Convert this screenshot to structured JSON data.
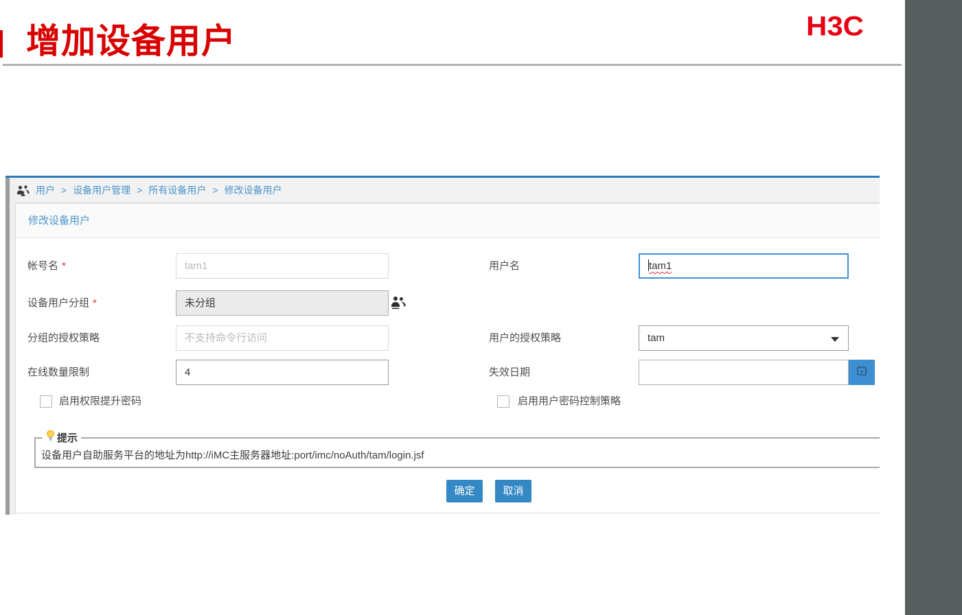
{
  "slide": {
    "title": "增加设备用户",
    "logo_text": "H3C"
  },
  "breadcrumb": {
    "separator": ">",
    "items": [
      "用户",
      "设备用户管理",
      "所有设备用户",
      "修改设备用户"
    ]
  },
  "panel": {
    "title": "修改设备用户"
  },
  "form": {
    "required_mark": "*",
    "account": {
      "label": "帐号名",
      "value": "tam1",
      "required": true,
      "state": "readonly"
    },
    "username": {
      "label": "用户名",
      "value": "tam1",
      "required": false,
      "state": "focused"
    },
    "group": {
      "label": "设备用户分组",
      "value": "未分组",
      "required": true,
      "state": "locked"
    },
    "group_policy": {
      "label": "分组的授权策略",
      "placeholder": "不支持命令行访问",
      "state": "readonly"
    },
    "user_policy": {
      "label": "用户的授权策略",
      "value": "tam",
      "control": "dropdown"
    },
    "online_limit": {
      "label": "在线数量限制",
      "value": "4"
    },
    "expire_date": {
      "label": "失效日期",
      "value": ""
    },
    "enable_priv_password": {
      "label": "启用权限提升密码",
      "checked": false
    },
    "enable_password_policy": {
      "label": "启用用户密码控制策略",
      "checked": false
    }
  },
  "tip": {
    "legend": "提示",
    "text": "设备用户自助服务平台的地址为http://iMC主服务器地址:port/imc/noAuth/tam/login.jsf"
  },
  "actions": {
    "ok": "确定",
    "cancel": "取消"
  },
  "icons": {
    "breadcrumb": "users-group-icon",
    "group_picker": "users-group-icon",
    "user_policy": "caret-down-icon",
    "expire_date": "calendar-icon",
    "tip": "lightbulb-icon"
  },
  "colors": {
    "title_red": "#d90000",
    "logo_red": "#e60012",
    "sidebar_gray": "#57605f",
    "topline_blue": "#2b7cba",
    "link_blue": "#4a96cb",
    "button_blue": "#3488c4",
    "calendar_button_blue": "#3e8ed2",
    "focus_border_blue": "#3f8fd5"
  }
}
